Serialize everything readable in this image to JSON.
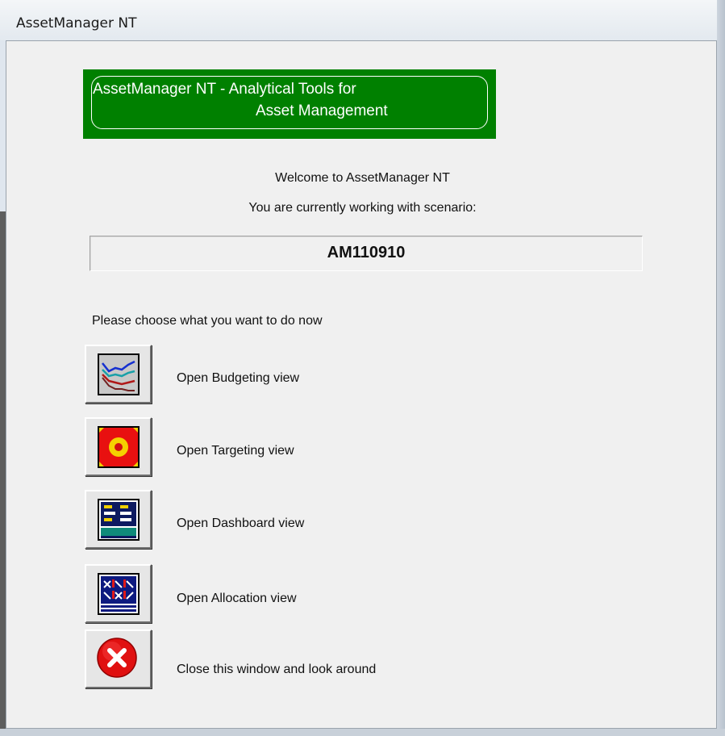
{
  "window": {
    "title": "AssetManager NT"
  },
  "banner": {
    "line1": "AssetManager NT - Analytical Tools for",
    "line2": "Asset  Management"
  },
  "welcome": {
    "line1": "Welcome to AssetManager NT",
    "line2": "You are currently working with scenario:"
  },
  "scenario": {
    "name": "AM110910"
  },
  "prompt": "Please choose what you want to do now",
  "actions": [
    {
      "icon": "budgeting-chart-icon",
      "label": "Open Budgeting view"
    },
    {
      "icon": "target-icon",
      "label": "Open Targeting view"
    },
    {
      "icon": "dashboard-icon",
      "label": "Open Dashboard view"
    },
    {
      "icon": "allocation-grid-icon",
      "label": "Open Allocation view"
    },
    {
      "icon": "close-icon",
      "label": "Close this window and look around"
    }
  ],
  "colors": {
    "banner_bg": "#008000",
    "banner_text": "#ffffff",
    "close_red": "#e01010"
  }
}
